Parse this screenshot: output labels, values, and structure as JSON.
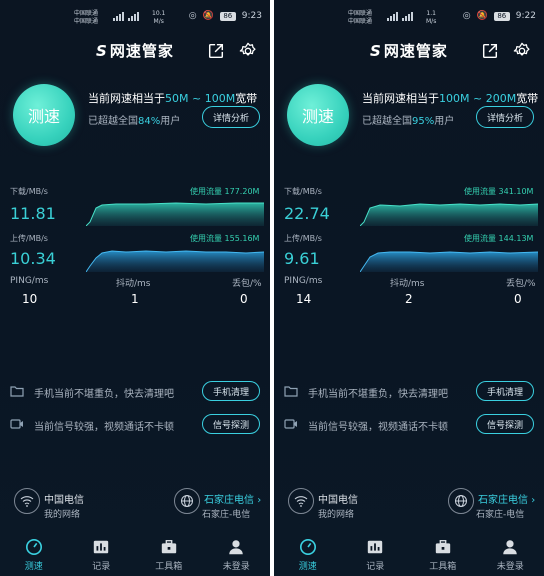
{
  "colors": {
    "accent": "#3ad0e0",
    "teal": "#34d0b0",
    "background": "#0b1522"
  },
  "screens": [
    {
      "status": {
        "carrier_1": "中国联通",
        "carrier_2": "中国联通",
        "net_speed_value": "10.1",
        "net_speed_unit": "M/s",
        "battery": "86",
        "time": "9:23"
      },
      "app_title": "网速管家",
      "speed_button": "测速",
      "equiv_prefix": "当前网速相当于",
      "equiv_range": "50M ~ 100M",
      "equiv_suffix": "宽带",
      "beat_prefix": "已超越全国",
      "beat_percent": "84%",
      "beat_suffix": "用户",
      "detail_button": "详情分析",
      "download_label": "下载/MB/s",
      "download_value": "11.81",
      "download_traffic": "使用流量 177.20M",
      "upload_label": "上传/MB/s",
      "upload_value": "10.34",
      "upload_traffic": "使用流量 155.16M",
      "ping_label": "PING/ms",
      "ping_value": "10",
      "jitter_label": "抖动/ms",
      "jitter_value": "1",
      "loss_label": "丢包/%",
      "loss_value": "0",
      "tip_clean_text": "手机当前不堪重负，快去清理吧",
      "tip_clean_button": "手机清理",
      "tip_signal_text": "当前信号较强，视频通话不卡顿",
      "tip_signal_button": "信号探测",
      "network_name": "中国电信",
      "network_sub": "我的网络",
      "city": "石家庄电信",
      "city_sub": "石家庄-电信",
      "nav": [
        "测速",
        "记录",
        "工具箱",
        "未登录"
      ]
    },
    {
      "status": {
        "carrier_1": "中国联通",
        "carrier_2": "中国联通",
        "net_speed_value": "1.1",
        "net_speed_unit": "M/s",
        "battery": "86",
        "time": "9:22"
      },
      "app_title": "网速管家",
      "speed_button": "测速",
      "equiv_prefix": "当前网速相当于",
      "equiv_range": "100M ~ 200M",
      "equiv_suffix": "宽带",
      "beat_prefix": "已超越全国",
      "beat_percent": "95%",
      "beat_suffix": "用户",
      "detail_button": "详情分析",
      "download_label": "下载/MB/s",
      "download_value": "22.74",
      "download_traffic": "使用流量 341.10M",
      "upload_label": "上传/MB/s",
      "upload_value": "9.61",
      "upload_traffic": "使用流量 144.13M",
      "ping_label": "PING/ms",
      "ping_value": "14",
      "jitter_label": "抖动/ms",
      "jitter_value": "2",
      "loss_label": "丢包/%",
      "loss_value": "0",
      "tip_clean_text": "手机当前不堪重负，快去清理吧",
      "tip_clean_button": "手机清理",
      "tip_signal_text": "当前信号较强，视频通话不卡顿",
      "tip_signal_button": "信号探测",
      "network_name": "中国电信",
      "network_sub": "我的网络",
      "city": "石家庄电信",
      "city_sub": "石家庄-电信",
      "nav": [
        "测速",
        "记录",
        "工具箱",
        "未登录"
      ]
    }
  ]
}
